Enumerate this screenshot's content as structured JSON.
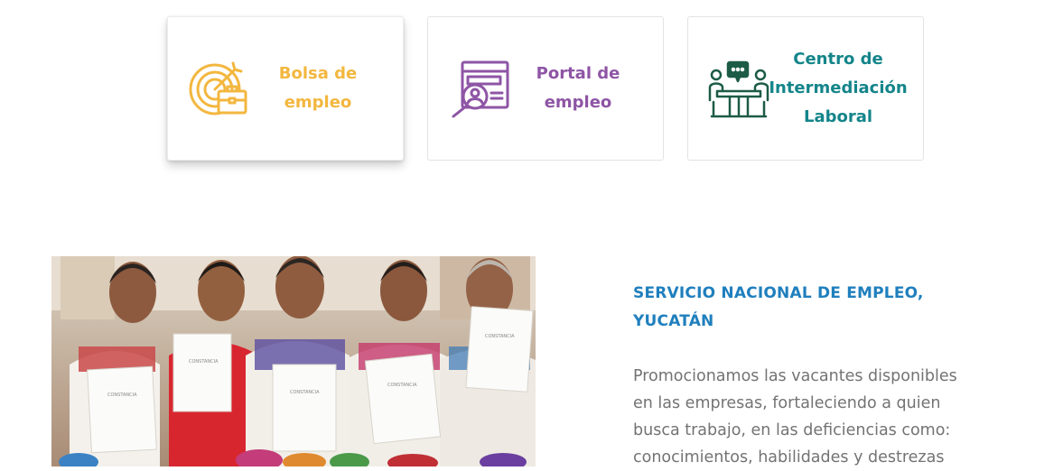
{
  "services": [
    {
      "label": "Bolsa de empleo",
      "icon": "target-briefcase-icon",
      "color": "#f3b73f"
    },
    {
      "label": "Portal de empleo",
      "icon": "web-search-profile-icon",
      "color": "#8e55a5"
    },
    {
      "label": "Centro de Intermediación Laboral",
      "icon": "meeting-table-icon",
      "color": "#14858a"
    }
  ],
  "section": {
    "title": "SERVICIO NACIONAL DE EMPLEO, YUCATÁN",
    "description": "Promocionamos las vacantes disponibles en las empresas, fortaleciendo a quien busca trabajo, en las deficiencias como: conocimientos, habilidades y destrezas",
    "accent": "#1f7fbd"
  },
  "photo": {
    "certificate_label": "CONSTANCIA"
  }
}
